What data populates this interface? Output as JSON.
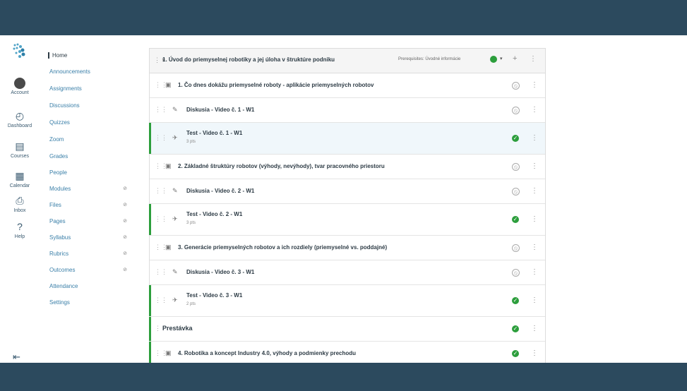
{
  "global_nav": {
    "account": "Account",
    "dashboard": "Dashboard",
    "courses": "Courses",
    "calendar": "Calendar",
    "inbox": "Inbox",
    "help": "Help"
  },
  "course_nav": [
    {
      "label": "Home",
      "hidden": false
    },
    {
      "label": "Announcements",
      "hidden": false
    },
    {
      "label": "Assignments",
      "hidden": false
    },
    {
      "label": "Discussions",
      "hidden": false
    },
    {
      "label": "Quizzes",
      "hidden": false
    },
    {
      "label": "Zoom",
      "hidden": false
    },
    {
      "label": "Grades",
      "hidden": false
    },
    {
      "label": "People",
      "hidden": false
    },
    {
      "label": "Modules",
      "hidden": true
    },
    {
      "label": "Files",
      "hidden": true
    },
    {
      "label": "Pages",
      "hidden": true
    },
    {
      "label": "Syllabus",
      "hidden": true
    },
    {
      "label": "Rubrics",
      "hidden": true
    },
    {
      "label": "Outcomes",
      "hidden": true
    },
    {
      "label": "Attendance",
      "hidden": false
    },
    {
      "label": "Settings",
      "hidden": false
    }
  ],
  "module": {
    "title": "1. Úvod do priemyselnej robotiky a jej úloha v štruktúre podniku",
    "prerequisites": "Prerequisites: Úvodné informácie",
    "items": [
      {
        "type": "page",
        "icon": "page-icon",
        "title": "1. Čo dnes dokážu priemyselné roboty - aplikácie priemyselných robotov",
        "sub": "",
        "published": false,
        "indent": 0
      },
      {
        "type": "discussion",
        "icon": "discussion-icon",
        "title": "Diskusia - Video č. 1 - W1",
        "sub": "",
        "published": false,
        "indent": 1
      },
      {
        "type": "quiz",
        "icon": "quiz-icon",
        "title": "Test - Video č. 1 - W1",
        "sub": "3 pts",
        "published": true,
        "indent": 1
      },
      {
        "type": "page",
        "icon": "page-icon",
        "title": "2. Základné štruktúry robotov (výhody, nevýhody), tvar pracovného priestoru",
        "sub": "",
        "published": false,
        "indent": 0
      },
      {
        "type": "discussion",
        "icon": "discussion-icon",
        "title": "Diskusia - Video č. 2 - W1",
        "sub": "",
        "published": false,
        "indent": 1
      },
      {
        "type": "quiz",
        "icon": "quiz-icon",
        "title": "Test - Video č. 2 - W1",
        "sub": "3 pts",
        "published": true,
        "indent": 1
      },
      {
        "type": "page",
        "icon": "page-icon",
        "title": "3. Generácie priemyselných robotov a ich rozdiely (priemyselné vs. poddajné)",
        "sub": "",
        "published": false,
        "indent": 0
      },
      {
        "type": "discussion",
        "icon": "discussion-icon",
        "title": "Diskusia - Video č. 3 - W1",
        "sub": "",
        "published": false,
        "indent": 1
      },
      {
        "type": "quiz",
        "icon": "quiz-icon",
        "title": "Test - Video č. 3 - W1",
        "sub": "2 pts",
        "published": true,
        "indent": 1
      },
      {
        "type": "header",
        "icon": "",
        "title": "Prestávka",
        "sub": "",
        "published": true,
        "indent": 0
      },
      {
        "type": "page",
        "icon": "page-icon",
        "title": "4. Robotika a koncept Industry 4.0, výhody a podmienky prechodu",
        "sub": "",
        "published": true,
        "indent": 0
      }
    ]
  },
  "colors": {
    "header_bar": "#2c4a5e",
    "published": "#2c9e3c",
    "link": "#3a7fa8"
  }
}
